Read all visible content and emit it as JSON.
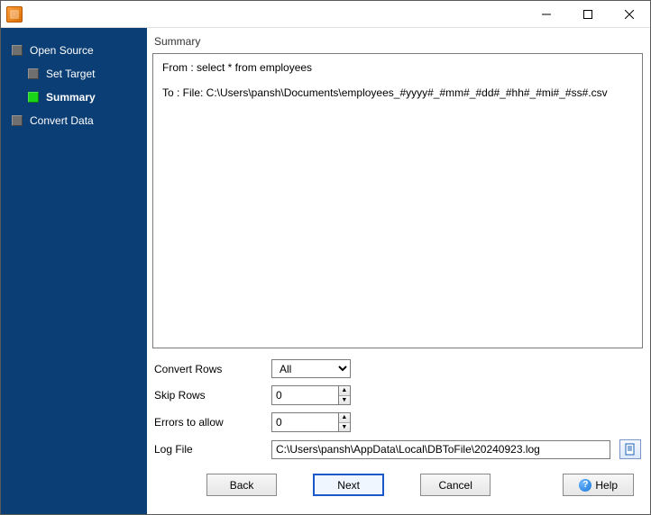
{
  "window": {
    "title": ""
  },
  "sidebar": {
    "items": [
      {
        "label": "Open Source",
        "indent": false,
        "active": false
      },
      {
        "label": "Set Target",
        "indent": true,
        "active": false
      },
      {
        "label": "Summary",
        "indent": true,
        "active": true
      },
      {
        "label": "Convert Data",
        "indent": false,
        "active": false
      }
    ]
  },
  "summary": {
    "heading": "Summary",
    "from_line": "From : select * from employees",
    "to_line": "To : File: C:\\Users\\pansh\\Documents\\employees_#yyyy#_#mm#_#dd#_#hh#_#mi#_#ss#.csv"
  },
  "form": {
    "convert_rows": {
      "label": "Convert Rows",
      "value": "All"
    },
    "skip_rows": {
      "label": "Skip Rows",
      "value": "0"
    },
    "errors_to_allow": {
      "label": "Errors to allow",
      "value": "0"
    },
    "log_file": {
      "label": "Log File",
      "value": "C:\\Users\\pansh\\AppData\\Local\\DBToFile\\20240923.log"
    }
  },
  "buttons": {
    "back": "Back",
    "next": "Next",
    "cancel": "Cancel",
    "help": "Help"
  }
}
